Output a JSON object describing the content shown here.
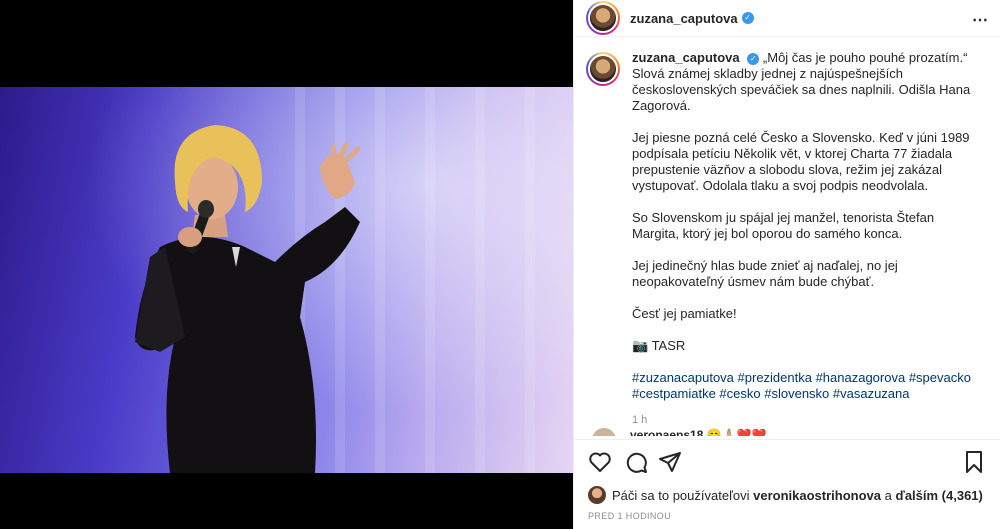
{
  "post": {
    "username": "zuzana_caputova",
    "verified_mark": "✓",
    "more_icon": "⋯",
    "photo_alt": "Hana Zagorová"
  },
  "caption": {
    "username": "zuzana_caputova",
    "p1": "„Môj čas je pouho pouhé prozatím.“ Slová známej skladby jednej z najúspešnejších československých speváčiek sa dnes naplnili. Odišla Hana Zagorová.",
    "p2": "Jej piesne pozná celé Česko a Slovensko. Keď v júni 1989 podpísala petíciu Několik vět, v ktorej Charta 77 žiadala prepustenie väzňov a slobodu slova, režim jej zakázal vystupovať. Odolala tlaku a svoj podpis neodvolala.",
    "p3": "So Slovenskom ju spájal jej manžel, tenorista Štefan Margita, ktorý jej bol oporou do samého konca.",
    "p4": "Jej jedinečný hlas bude znieť aj naďalej, no jej neopakovateľný úsmev nám bude chýbať.",
    "p5": "Česť jej pamiatke!",
    "p6": "📷 TASR",
    "hashtags": "#zuzanacaputova #prezidentka #hanazagorova #spevacko #cestpamiatke #cesko #slovensko #vasazuzana",
    "time": "1 h"
  },
  "comment_peek": {
    "name": "veronaeps18 😊🙏🏼❤️❤️"
  },
  "actions": {
    "like_icon": "heart-icon",
    "comment_icon": "comment-icon",
    "share_icon": "share-icon",
    "save_icon": "bookmark-icon"
  },
  "likes": {
    "prefix": "Páči sa to používateľovi",
    "user": "veronikaostrihonova",
    "middle": "a",
    "others": "ďalším (4,361)"
  },
  "posted": "PRED 1 HODINOU"
}
